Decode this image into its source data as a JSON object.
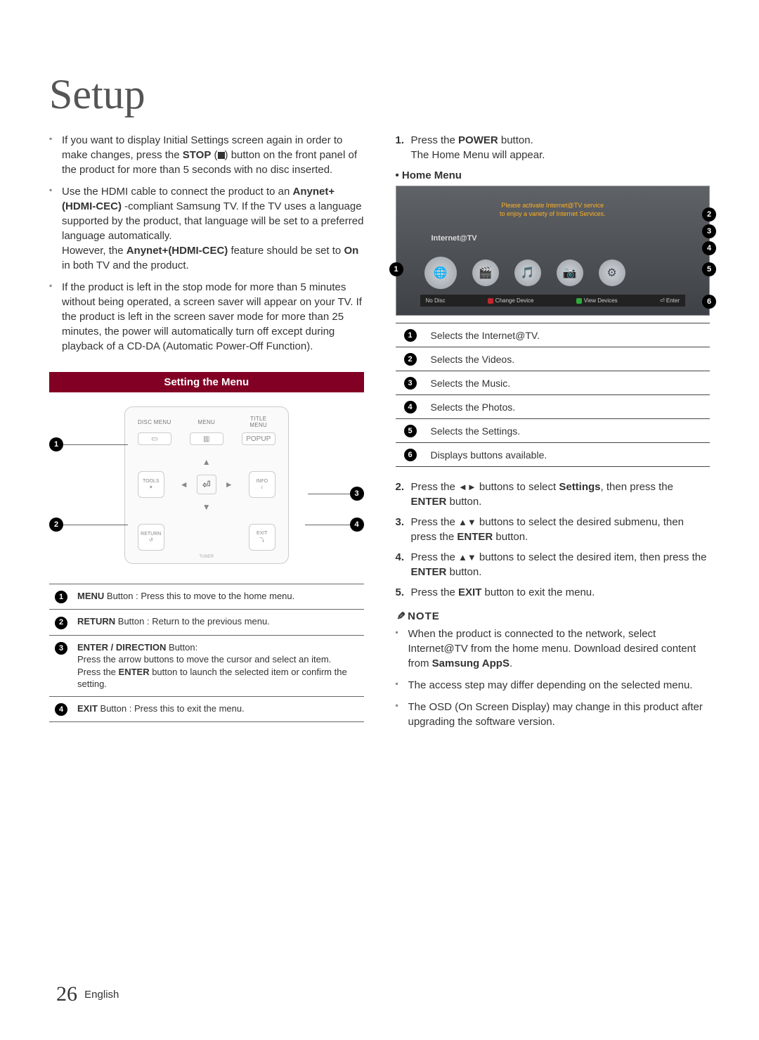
{
  "title": "Setup",
  "left_bullets": {
    "b1_a": "If you want to display Initial Settings screen again in order to make changes, press the ",
    "b1_b": "STOP",
    "b1_c": " button on the front panel of the product for more than 5 seconds with no disc inserted.",
    "b2_a": "Use the HDMI cable to connect the product to an ",
    "b2_b": "Anynet+(HDMI-CEC)",
    "b2_c": "-compliant Samsung TV. If the TV uses a language supported by the product, that language will be set to a preferred language automatically.",
    "b2_d": "However, the ",
    "b2_e": "Anynet+(HDMI-CEC)",
    "b2_f": " feature should be set to ",
    "b2_g": "On",
    "b2_h": " in both TV and the product.",
    "b3": "If the product is left in the stop mode for more than 5 minutes without being operated, a screen saver will appear on your TV. If the product is left in the screen saver mode for more than 25 minutes, the power will automatically turn off except during playback of a CD-DA (Automatic Power-Off Function)."
  },
  "section_bar": "Setting the Menu",
  "remote": {
    "disc_menu": "DISC MENU",
    "menu": "MENU",
    "title_menu": "TITLE MENU",
    "popup": "POPUP",
    "tools": "TOOLS",
    "info": "INFO",
    "return": "RETURN",
    "exit": "EXIT",
    "foot": "TUNER"
  },
  "remote_table": [
    {
      "b1": "MENU",
      "b2": " Button : Press this to move to the home menu."
    },
    {
      "b1": "RETURN",
      "b2": " Button : Return to the previous menu."
    },
    {
      "b1": "ENTER / DIRECTION",
      "b2": " Button:",
      "b3": "Press the arrow buttons to move the cursor and select an item.",
      "b4a": "Press the ",
      "b4b": "ENTER",
      "b4c": " button to launch the selected item or confirm the setting."
    },
    {
      "b1": "EXIT",
      "b2": " Button : Press this to exit the menu."
    }
  ],
  "right_steps": {
    "s1a": "Press the ",
    "s1b": "POWER",
    "s1c": " button.",
    "s1d": "The Home Menu will appear.",
    "home_heading": "• Home Menu"
  },
  "home_image": {
    "msg1": "Please activate Internet@TV service",
    "msg2": "to enjoy a variety of Internet Services.",
    "label": "Internet@TV",
    "bar_left": "No Disc",
    "bar_change": "Change Device",
    "bar_view": "View Devices",
    "bar_enter": "Enter"
  },
  "home_table": [
    "Selects the Internet@TV.",
    "Selects the Videos.",
    "Selects the Music.",
    "Selects the Photos.",
    "Selects the Settings.",
    "Displays buttons available."
  ],
  "right_steps2": {
    "s2a": "Press the ",
    "s2b": "◄►",
    "s2c": " buttons to select ",
    "s2d": "Settings",
    "s2e": ", then press the ",
    "s2f": "ENTER",
    "s2g": " button.",
    "s3a": "Press the ",
    "s3b": "▲▼",
    "s3c": " buttons to select the desired submenu, then press the ",
    "s3d": "ENTER",
    "s3e": " button.",
    "s4a": "Press the ",
    "s4b": "▲▼",
    "s4c": " buttons to select the desired item, then press the ",
    "s4d": "ENTER",
    "s4e": " button.",
    "s5a": "Press the ",
    "s5b": "EXIT",
    "s5c": " button to exit the menu."
  },
  "note_heading": "NOTE",
  "notes": {
    "n1a": "When the product is connected to the network, select Internet@TV from the home menu. Download desired content from ",
    "n1b": "Samsung AppS",
    "n1c": ".",
    "n2": "The access step may differ depending on the selected menu.",
    "n3": "The OSD (On Screen Display) may change in this product after upgrading the software version."
  },
  "footer": {
    "page": "26",
    "lang": "English"
  }
}
